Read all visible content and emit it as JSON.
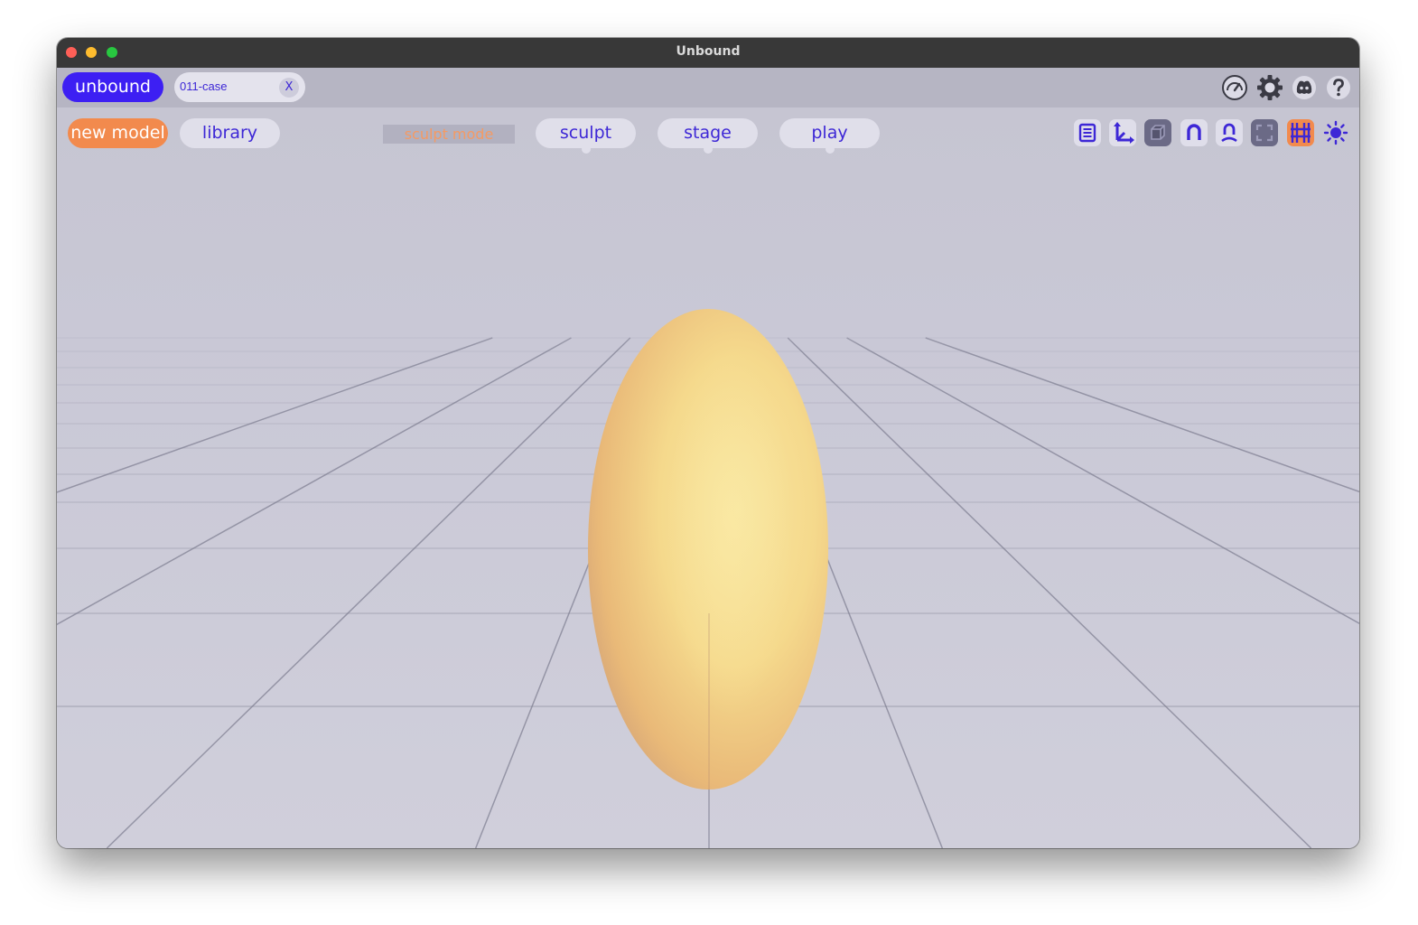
{
  "window": {
    "title": "Unbound"
  },
  "tabbar": {
    "brand_label": "unbound",
    "document_tab": {
      "name": "011-case",
      "close_label": "X"
    },
    "icons": [
      "performance-gauge-icon",
      "settings-gear-icon",
      "discord-icon",
      "help-icon"
    ]
  },
  "toolbar": {
    "new_model_label": "new model",
    "library_label": "library",
    "mode_label": "sculpt mode",
    "mode_tabs": [
      "sculpt",
      "stage",
      "play"
    ],
    "view_tools": [
      "outliner-list-icon",
      "axes-gizmo-icon",
      "solid-shading-cube-icon",
      "magnet-snap-icon",
      "magnet-person-icon",
      "fullscreen-frame-icon",
      "grid-toggle-icon",
      "lighting-sun-icon"
    ]
  },
  "colors": {
    "accent": "#3d1ff3",
    "action": "#f28a4d",
    "viewport_bg": "#c9c8d6",
    "model": "#f6d789"
  }
}
